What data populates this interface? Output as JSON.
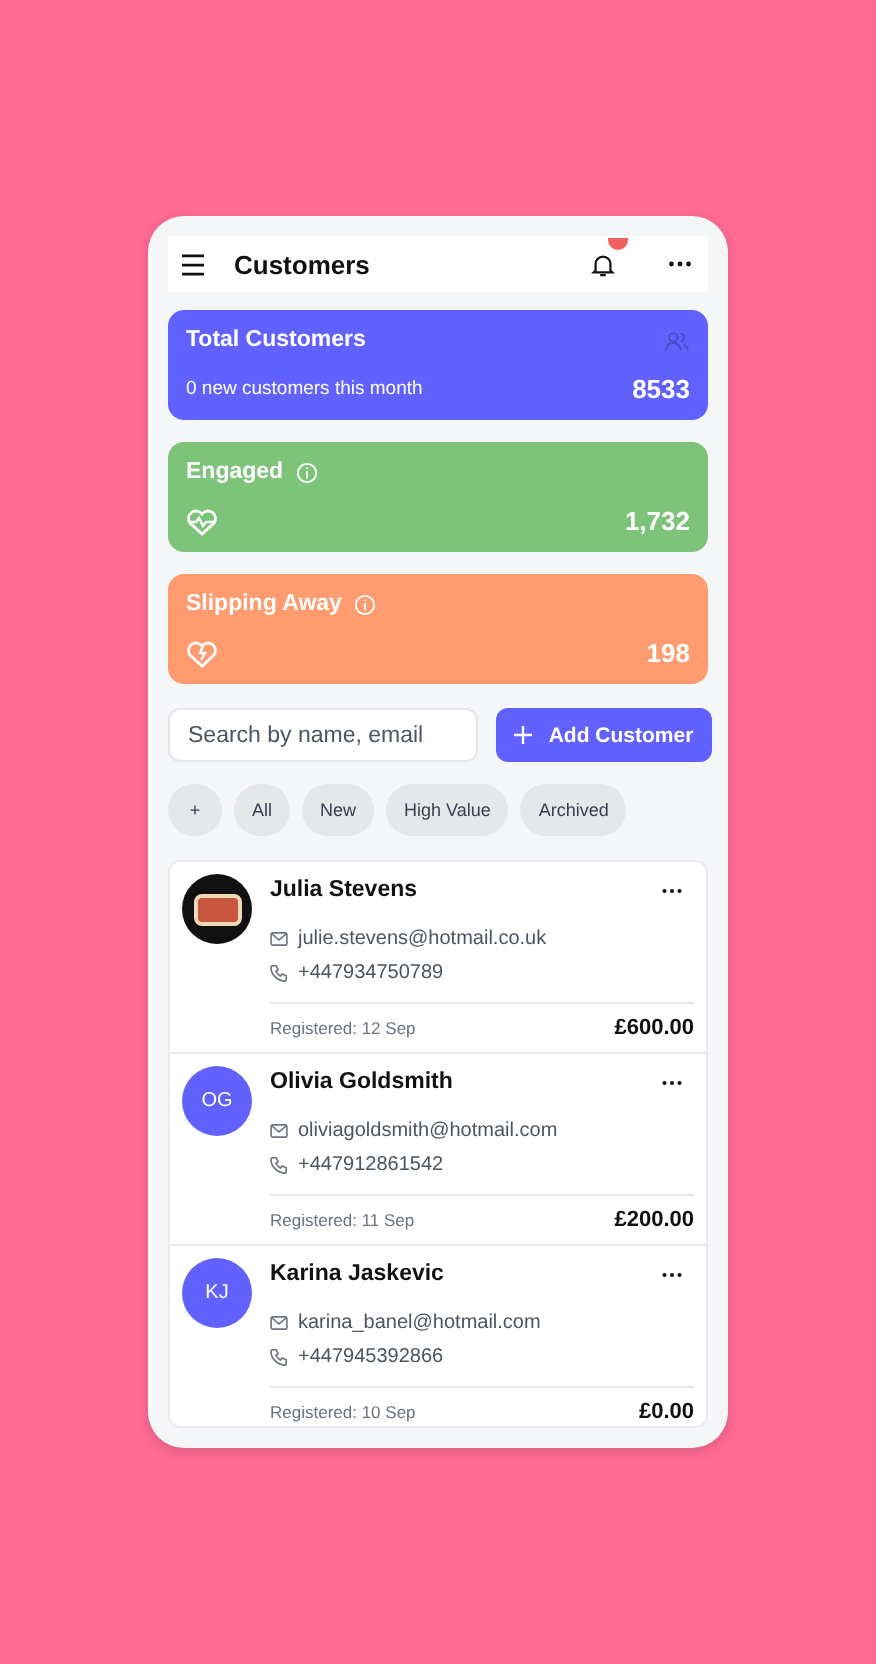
{
  "header": {
    "title": "Customers"
  },
  "stats": [
    {
      "kind": "users",
      "title": "Total Customers",
      "subtitle": "0 new customers this month",
      "value": "8533",
      "color": "#6161ff"
    },
    {
      "kind": "heart",
      "title": "Engaged",
      "info": true,
      "value": "1,732",
      "color": "#7dc47a"
    },
    {
      "kind": "broken-heart",
      "title": "Slipping Away",
      "info": true,
      "value": "198",
      "color": "#ff9b6e"
    }
  ],
  "search": {
    "placeholder": "Search by name, email"
  },
  "add_button": "Add Customer",
  "filters": [
    "+",
    "All",
    "New",
    "High Value",
    "Archived"
  ],
  "customers": [
    {
      "kind": "photo",
      "name": "Julia Stevens",
      "email": "julie.stevens@hotmail.co.uk",
      "phone": "+447934750789",
      "registered": "Registered: 12 Sep",
      "amount": "£600.00"
    },
    {
      "kind": "initials",
      "initials": "OG",
      "name": "Olivia Goldsmith",
      "email": "oliviagoldsmith@hotmail.com",
      "phone": "+447912861542",
      "registered": "Registered: 11 Sep",
      "amount": "£200.00"
    },
    {
      "kind": "initials",
      "initials": "KJ",
      "name": "Karina Jaskevic",
      "email": "karina_banel@hotmail.com",
      "phone": "+447945392866",
      "registered": "Registered: 10 Sep",
      "amount": "£0.00"
    }
  ]
}
